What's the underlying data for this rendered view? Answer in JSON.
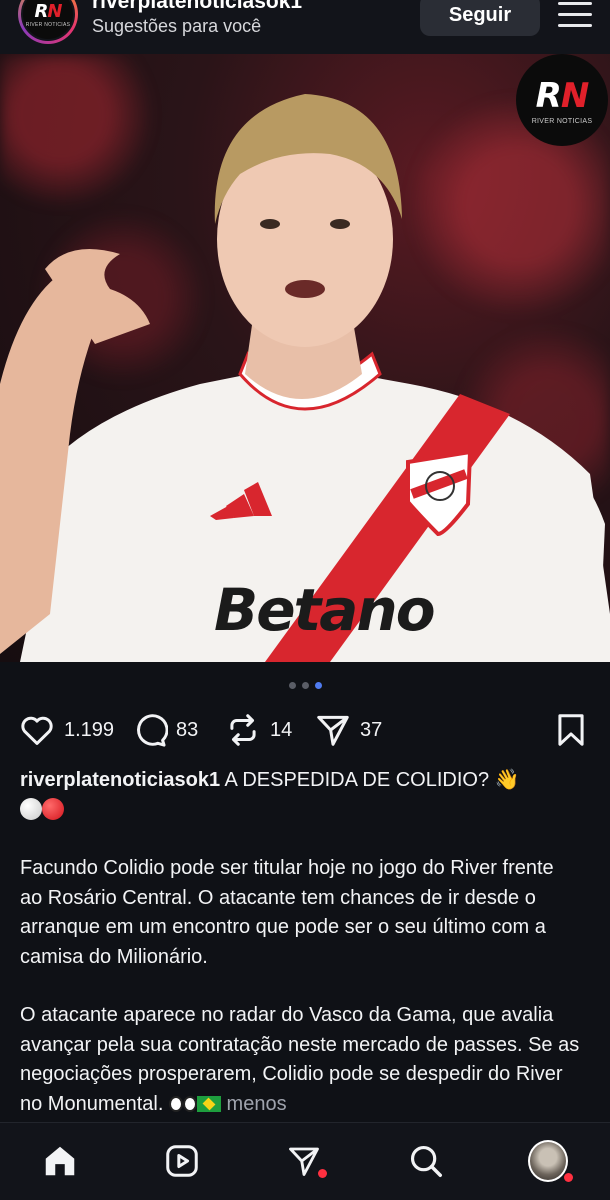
{
  "header": {
    "username": "riverplatenoticiasok1",
    "subtitle": "Sugestões para você",
    "follow_label": "Seguir",
    "logo_letters": "RN",
    "logo_caption": "RIVER NOTICIAS"
  },
  "post": {
    "image": {
      "badge_letters": "RN",
      "badge_caption": "RIVER NOTICIAS",
      "sponsor_text": "Betano"
    },
    "carousel": {
      "count": 3,
      "active_index": 2
    },
    "actions": {
      "likes": "1.199",
      "comments": "83",
      "reposts": "14",
      "shares": "37"
    },
    "caption": {
      "author": "riverplatenoticiasok1",
      "headline": " A DESPEDIDA DE COLIDIO? 👋",
      "paragraph1": "Facundo Colidio pode ser titular hoje no jogo do River frente ao Rosário Central. O atacante tem chances de ir desde o arranque em um encontro que pode ser o seu último com a camisa do Milionário.",
      "paragraph2": "O atacante aparece no radar do Vasco da Gama, que avalia avançar pela sua contratação neste mercado de passes. Se as negociações prosperarem, Colidio pode se despedir do River no Monumental.",
      "more_label": "menos"
    }
  },
  "nav": {
    "items": [
      "home-icon",
      "reels-icon",
      "send-icon",
      "search-icon",
      "profile-avatar"
    ]
  },
  "colors": {
    "background": "#0f1116",
    "accent_dot": "#4f7bf0",
    "notification": "#ff3040",
    "river_red": "#e0202a"
  }
}
